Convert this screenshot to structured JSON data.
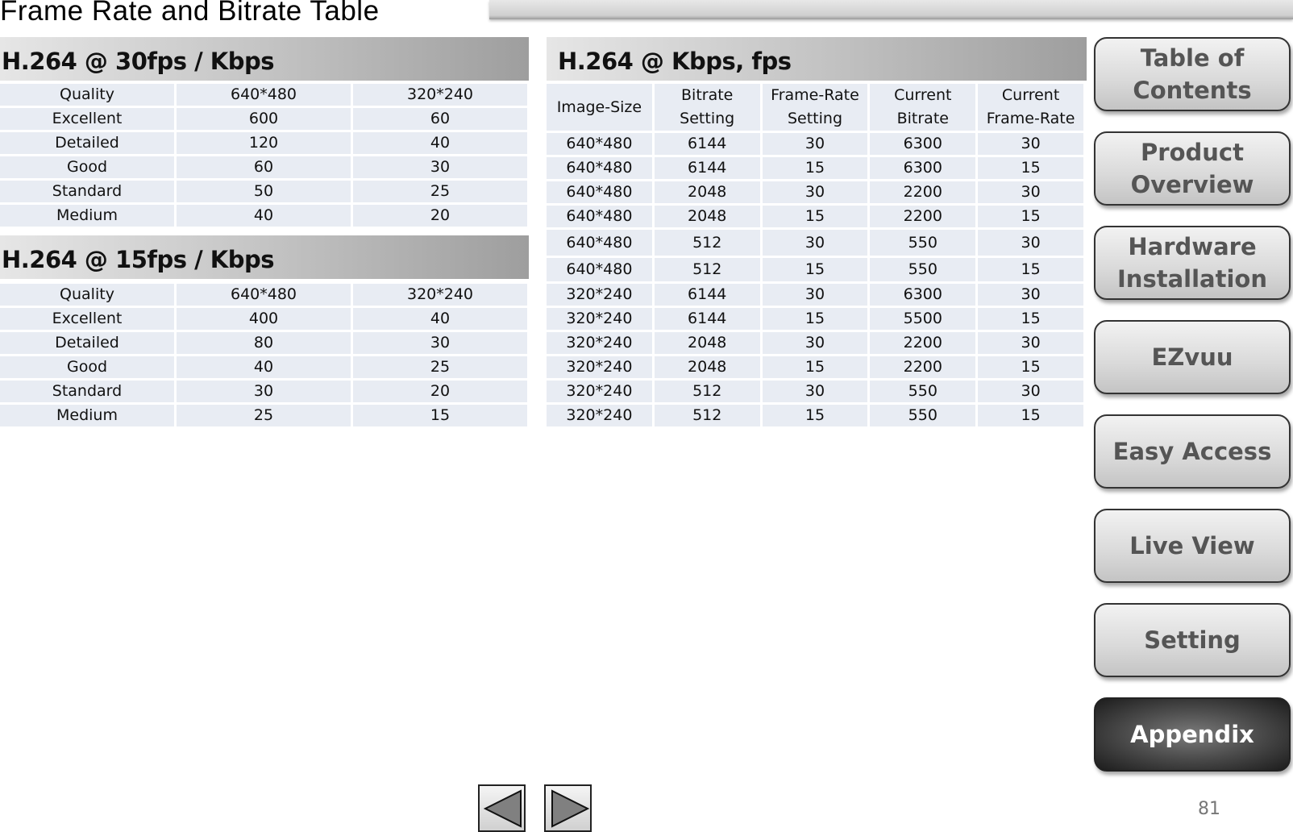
{
  "page": {
    "title": "Frame Rate and Bitrate Table",
    "page_number": "81"
  },
  "table_30fps": {
    "title": "H.264 @ 30fps / Kbps",
    "headers": [
      "Quality",
      "640*480",
      "320*240"
    ],
    "rows": [
      [
        "Excellent",
        "600",
        "60"
      ],
      [
        "Detailed",
        "120",
        "40"
      ],
      [
        "Good",
        "60",
        "30"
      ],
      [
        "Standard",
        "50",
        "25"
      ],
      [
        "Medium",
        "40",
        "20"
      ]
    ]
  },
  "table_15fps": {
    "title": "H.264 @ 15fps / Kbps",
    "headers": [
      "Quality",
      "640*480",
      "320*240"
    ],
    "rows": [
      [
        "Excellent",
        "400",
        "40"
      ],
      [
        "Detailed",
        "80",
        "30"
      ],
      [
        "Good",
        "40",
        "25"
      ],
      [
        "Standard",
        "30",
        "20"
      ],
      [
        "Medium",
        "25",
        "15"
      ]
    ]
  },
  "table_kbps_fps": {
    "title": "H.264 @ Kbps, fps",
    "headers": [
      [
        "Image-Size"
      ],
      [
        "Bitrate",
        "Setting"
      ],
      [
        "Frame-Rate",
        "Setting"
      ],
      [
        "Current",
        "Bitrate"
      ],
      [
        "Current",
        "Frame-Rate"
      ]
    ],
    "rows": [
      [
        "640*480",
        "6144",
        "30",
        "6300",
        "30"
      ],
      [
        "640*480",
        "6144",
        "15",
        "6300",
        "15"
      ],
      [
        "640*480",
        "2048",
        "30",
        "2200",
        "30"
      ],
      [
        "640*480",
        "2048",
        "15",
        "2200",
        "15"
      ],
      [
        "640*480",
        "512",
        "30",
        "550",
        "30"
      ],
      [
        "640*480",
        "512",
        "15",
        "550",
        "15"
      ],
      [
        "320*240",
        "6144",
        "30",
        "6300",
        "30"
      ],
      [
        "320*240",
        "6144",
        "15",
        "5500",
        "15"
      ],
      [
        "320*240",
        "2048",
        "30",
        "2200",
        "30"
      ],
      [
        "320*240",
        "2048",
        "15",
        "2200",
        "15"
      ],
      [
        "320*240",
        "512",
        "30",
        "550",
        "30"
      ],
      [
        "320*240",
        "512",
        "15",
        "550",
        "15"
      ]
    ]
  },
  "nav": {
    "items": [
      {
        "label": "Table of Contents",
        "lines": [
          "Table of",
          "Contents"
        ],
        "active": false
      },
      {
        "label": "Product Overview",
        "lines": [
          "Product",
          "Overview"
        ],
        "active": false
      },
      {
        "label": "Hardware Installation",
        "lines": [
          "Hardware",
          "Installation"
        ],
        "active": false
      },
      {
        "label": "EZvuu",
        "lines": [
          "EZvuu"
        ],
        "active": false
      },
      {
        "label": "Easy Access",
        "lines": [
          "Easy Access"
        ],
        "active": false
      },
      {
        "label": "Live View",
        "lines": [
          "Live View"
        ],
        "active": false
      },
      {
        "label": "Setting",
        "lines": [
          "Setting"
        ],
        "active": false
      },
      {
        "label": "Appendix",
        "lines": [
          "Appendix"
        ],
        "active": true
      }
    ],
    "prev_icon": "triangle-left-icon",
    "next_icon": "triangle-right-icon"
  }
}
